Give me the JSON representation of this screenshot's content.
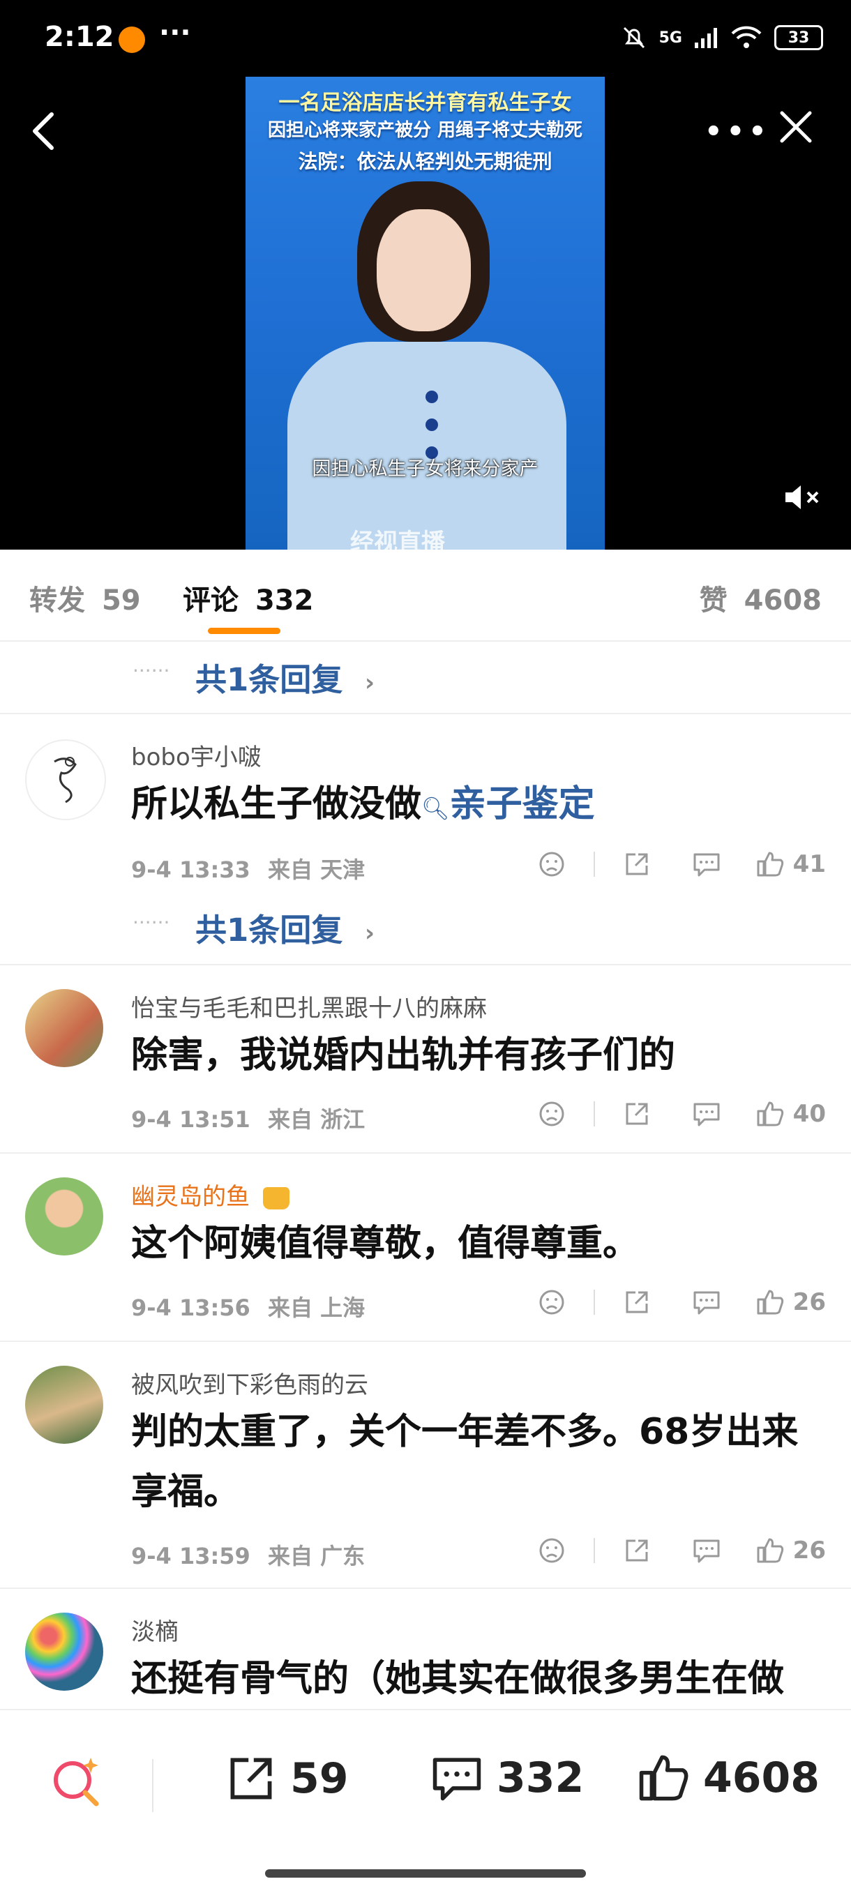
{
  "status_bar": {
    "time": "2:12",
    "overflow": "···",
    "network": "5G",
    "battery": "33"
  },
  "video": {
    "headline_line1": "一名足浴店店长并育有私生子女",
    "headline_line2": "因担心将来家产被分 用绳子将丈夫勒死",
    "headline_line3": "法院：依法从轻判处无期徒刑",
    "subtitle": "因担心私生子女将来分家产",
    "logo_text": "经视直播"
  },
  "tabs": {
    "repost_label": "转发",
    "repost_count": "59",
    "comment_label": "评论",
    "comment_count": "332",
    "like_label": "赞",
    "like_count": "4608"
  },
  "reply_link_text": "共1条回复",
  "comments": [
    {
      "user": "bobo宇小啵",
      "content_before": "所以私生子做没做",
      "content_link": "亲子鉴定",
      "date": "9-4 13:33",
      "location": "来自 天津",
      "likes": "41"
    },
    {
      "user": "怡宝与毛毛和巴扎黑跟十八的麻麻",
      "content": "除害，我说婚内出轨并有孩子们的",
      "date": "9-4 13:51",
      "location": "来自 浙江",
      "likes": "40"
    },
    {
      "user": "幽灵岛的鱼",
      "content": "这个阿姨值得尊敬，值得尊重。",
      "date": "9-4 13:56",
      "location": "来自 上海",
      "likes": "26"
    },
    {
      "user": "被风吹到下彩色雨的云",
      "content": "判的太重了，关个一年差不多。68岁出来享福。",
      "date": "9-4 13:59",
      "location": "来自 广东",
      "likes": "26"
    },
    {
      "user": "淡樀",
      "content": "还挺有骨气的（她其实在做很多男生在做的事情）比好多隐忍派厉害了"
    }
  ],
  "bottom_bar": {
    "repost_count": "59",
    "comment_count": "332",
    "like_count": "4608"
  },
  "colors": {
    "accent": "#ff8a00",
    "link": "#2f5f9e",
    "vip_name": "#e8731a"
  }
}
